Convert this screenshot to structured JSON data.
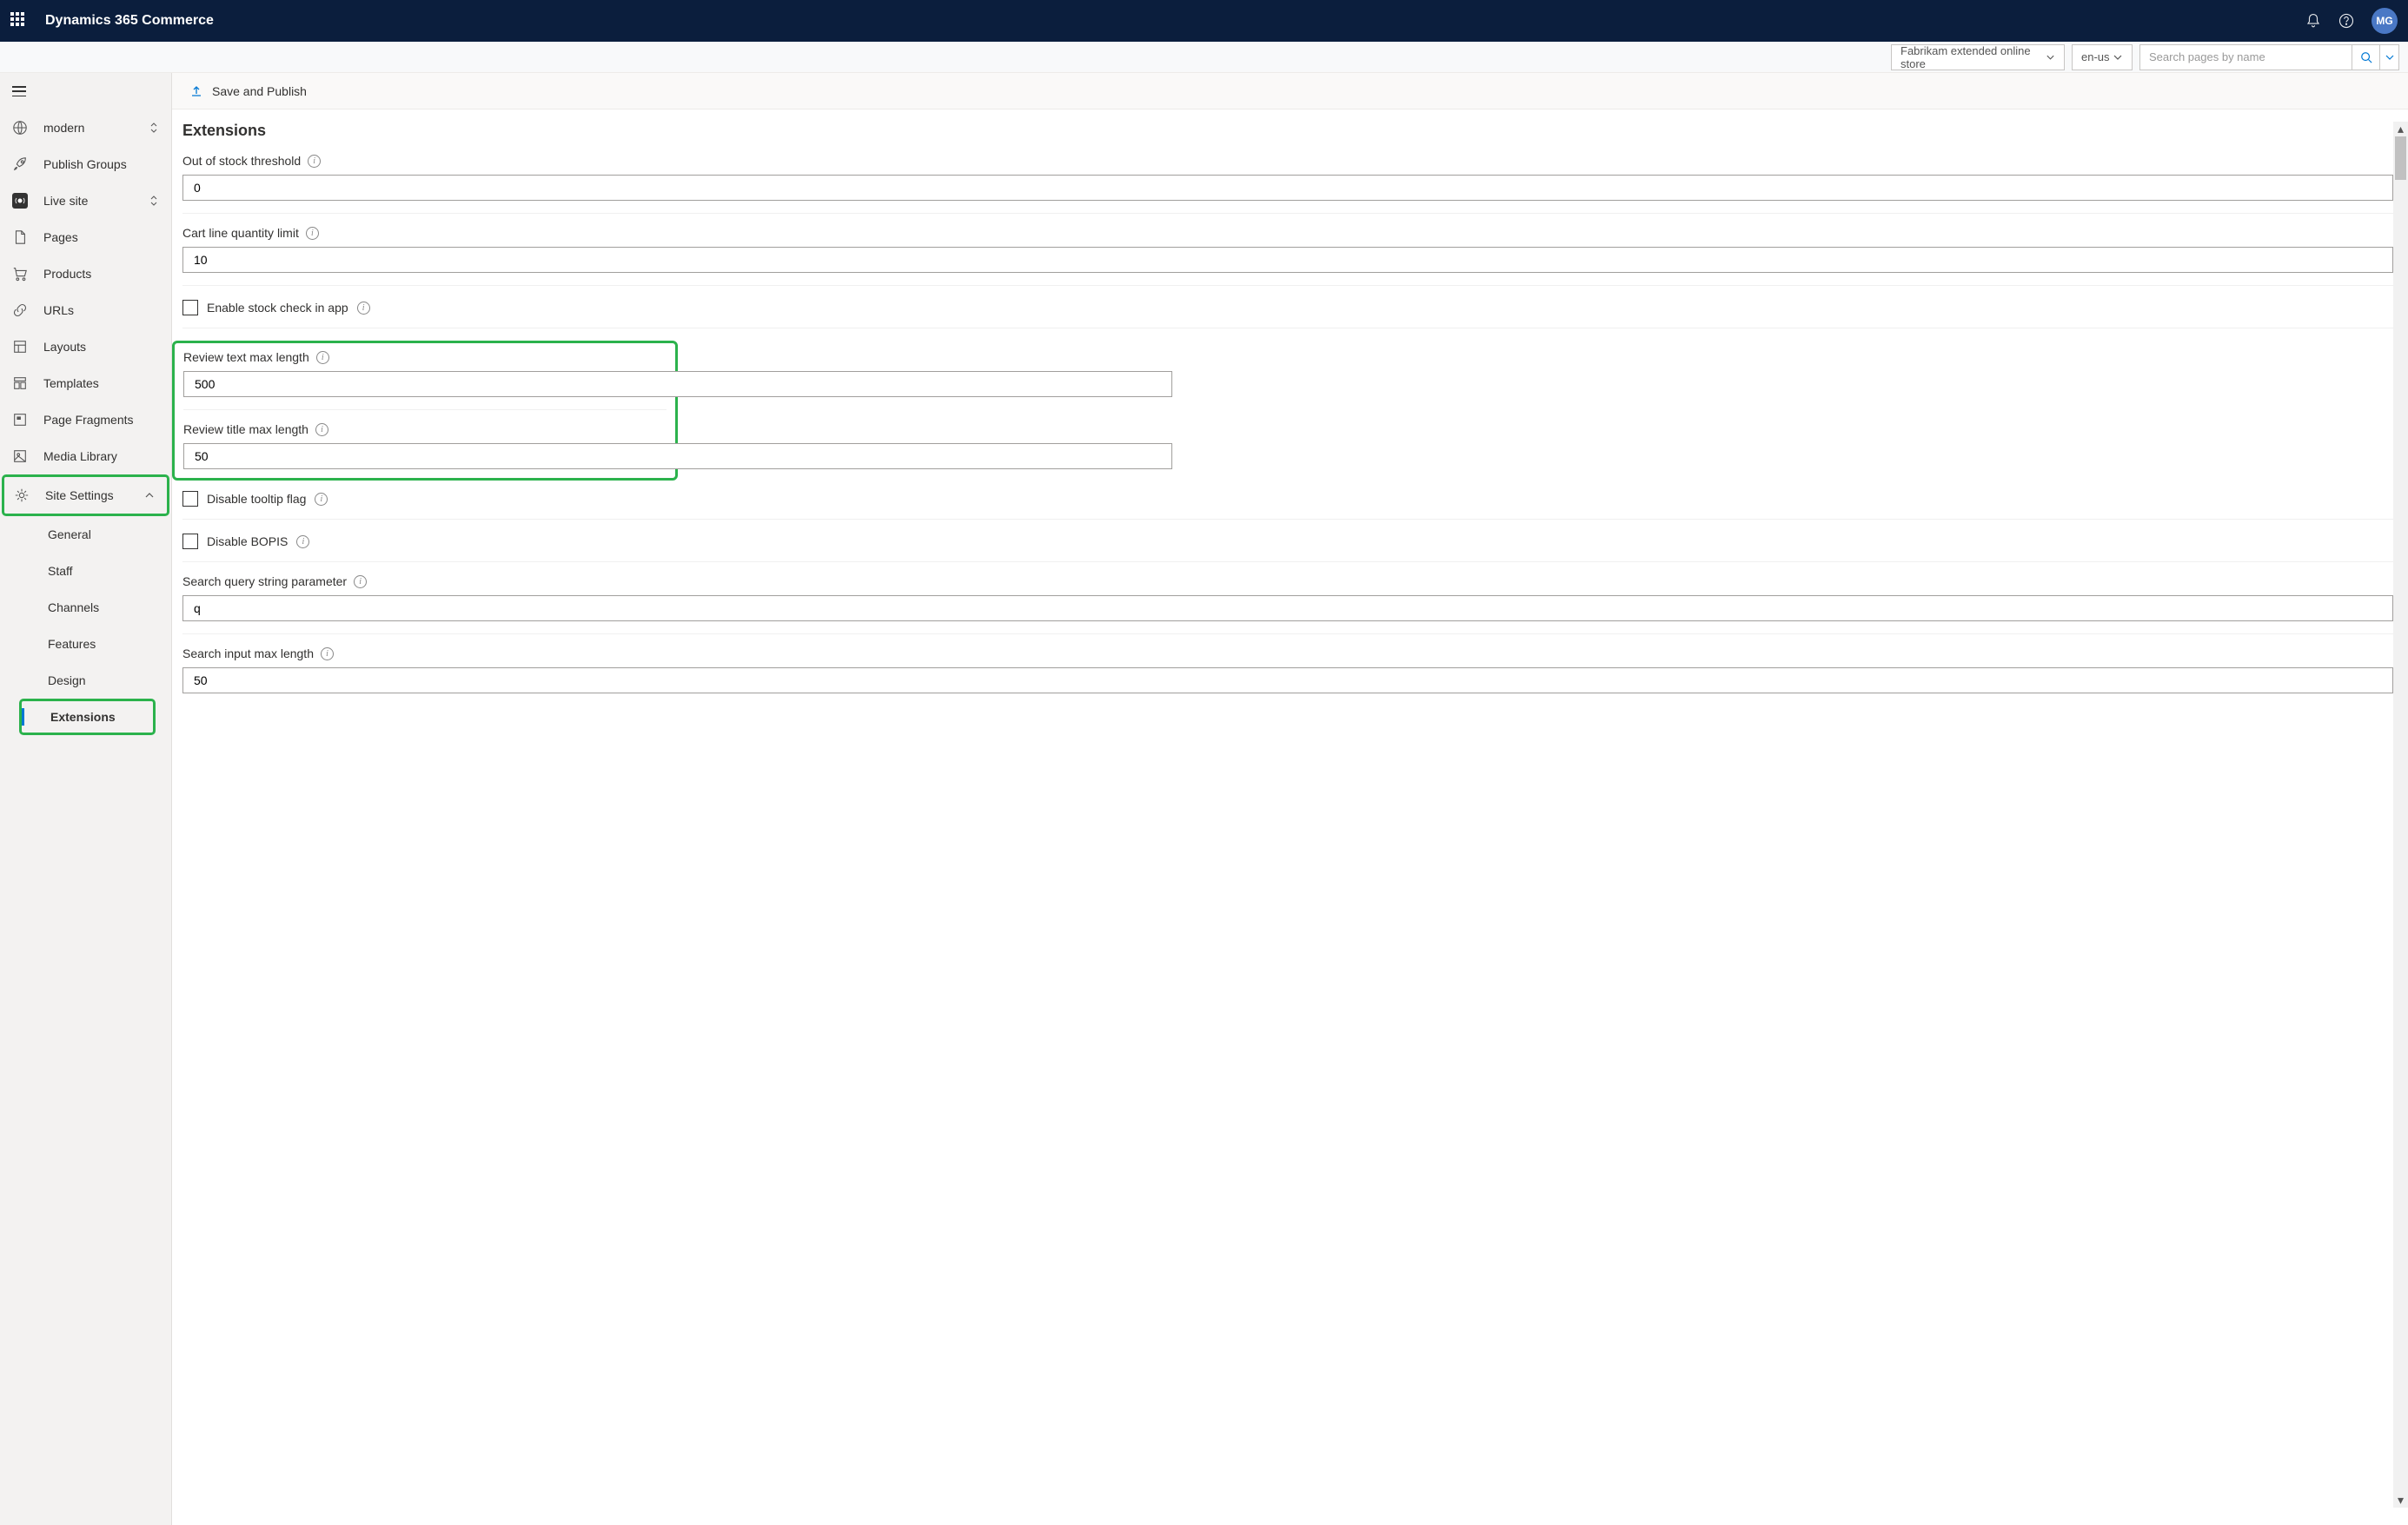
{
  "app": {
    "title": "Dynamics 365 Commerce",
    "avatar": "MG"
  },
  "subbar": {
    "site": "Fabrikam extended online store",
    "locale": "en-us",
    "search_placeholder": "Search pages by name"
  },
  "sidebar": {
    "site_name": "modern",
    "items": {
      "publish_groups": "Publish Groups",
      "live_site": "Live site",
      "pages": "Pages",
      "products": "Products",
      "urls": "URLs",
      "layouts": "Layouts",
      "templates": "Templates",
      "fragments": "Page Fragments",
      "media": "Media Library",
      "site_settings": "Site Settings"
    },
    "settings_sub": {
      "general": "General",
      "staff": "Staff",
      "channels": "Channels",
      "features": "Features",
      "design": "Design",
      "extensions": "Extensions"
    }
  },
  "cmdbar": {
    "save": "Save and Publish"
  },
  "page": {
    "title": "Extensions",
    "fields": {
      "out_of_stock": {
        "label": "Out of stock threshold",
        "value": "0"
      },
      "cart_limit": {
        "label": "Cart line quantity limit",
        "value": "10"
      },
      "stock_check": {
        "label": "Enable stock check in app"
      },
      "review_text": {
        "label": "Review text max length",
        "value": "500"
      },
      "review_title": {
        "label": "Review title max length",
        "value": "50"
      },
      "disable_tooltip": {
        "label": "Disable tooltip flag"
      },
      "disable_bopis": {
        "label": "Disable BOPIS"
      },
      "search_param": {
        "label": "Search query string parameter",
        "value": "q"
      },
      "search_max": {
        "label": "Search input max length",
        "value": "50"
      }
    }
  }
}
